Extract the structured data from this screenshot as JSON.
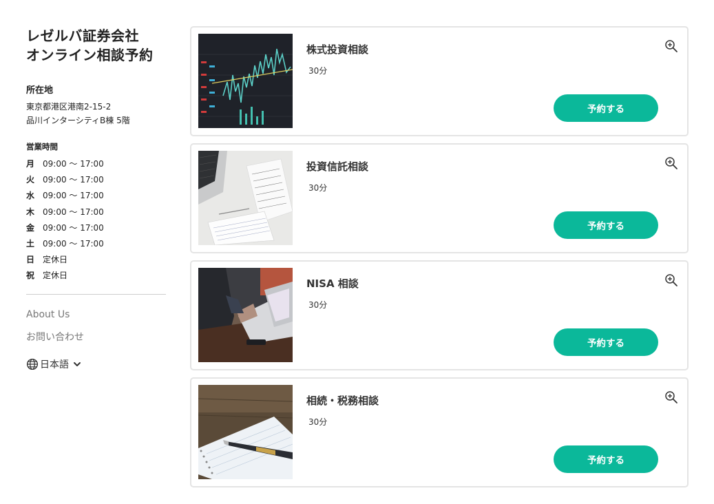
{
  "company": {
    "name_line1": "レゼルバ証券会社",
    "name_line2": "オンライン相談予約"
  },
  "location": {
    "title": "所在地",
    "address_line1": "東京都港区港南2-15-2",
    "address_line2": "品川インターシティB棟 5階"
  },
  "hours": {
    "title": "営業時間",
    "rows": [
      {
        "day": "月",
        "time": "09:00 〜 17:00"
      },
      {
        "day": "火",
        "time": "09:00 〜 17:00"
      },
      {
        "day": "水",
        "time": "09:00 〜 17:00"
      },
      {
        "day": "木",
        "time": "09:00 〜 17:00"
      },
      {
        "day": "金",
        "time": "09:00 〜 17:00"
      },
      {
        "day": "土",
        "time": "09:00 〜 17:00"
      },
      {
        "day": "日",
        "time": "定休日"
      },
      {
        "day": "祝",
        "time": "定休日"
      }
    ]
  },
  "links": {
    "about": "About Us",
    "contact": "お問い合わせ"
  },
  "language": {
    "label": "日本語",
    "icon": "globe-icon"
  },
  "services": [
    {
      "title": "株式投資相談",
      "duration": "30分",
      "button": "予約する",
      "image": "stock-chart-photo"
    },
    {
      "title": "投資信託相談",
      "duration": "30分",
      "button": "予約する",
      "image": "documents-laptop-photo"
    },
    {
      "title": "NISA 相談",
      "duration": "30分",
      "button": "予約する",
      "image": "laptop-meeting-photo"
    },
    {
      "title": "相続・税務相談",
      "duration": "30分",
      "button": "予約する",
      "image": "notebook-pen-photo"
    }
  ],
  "colors": {
    "accent": "#0bb89a",
    "card_border": "#e4e4e4",
    "muted_text": "#777777"
  }
}
